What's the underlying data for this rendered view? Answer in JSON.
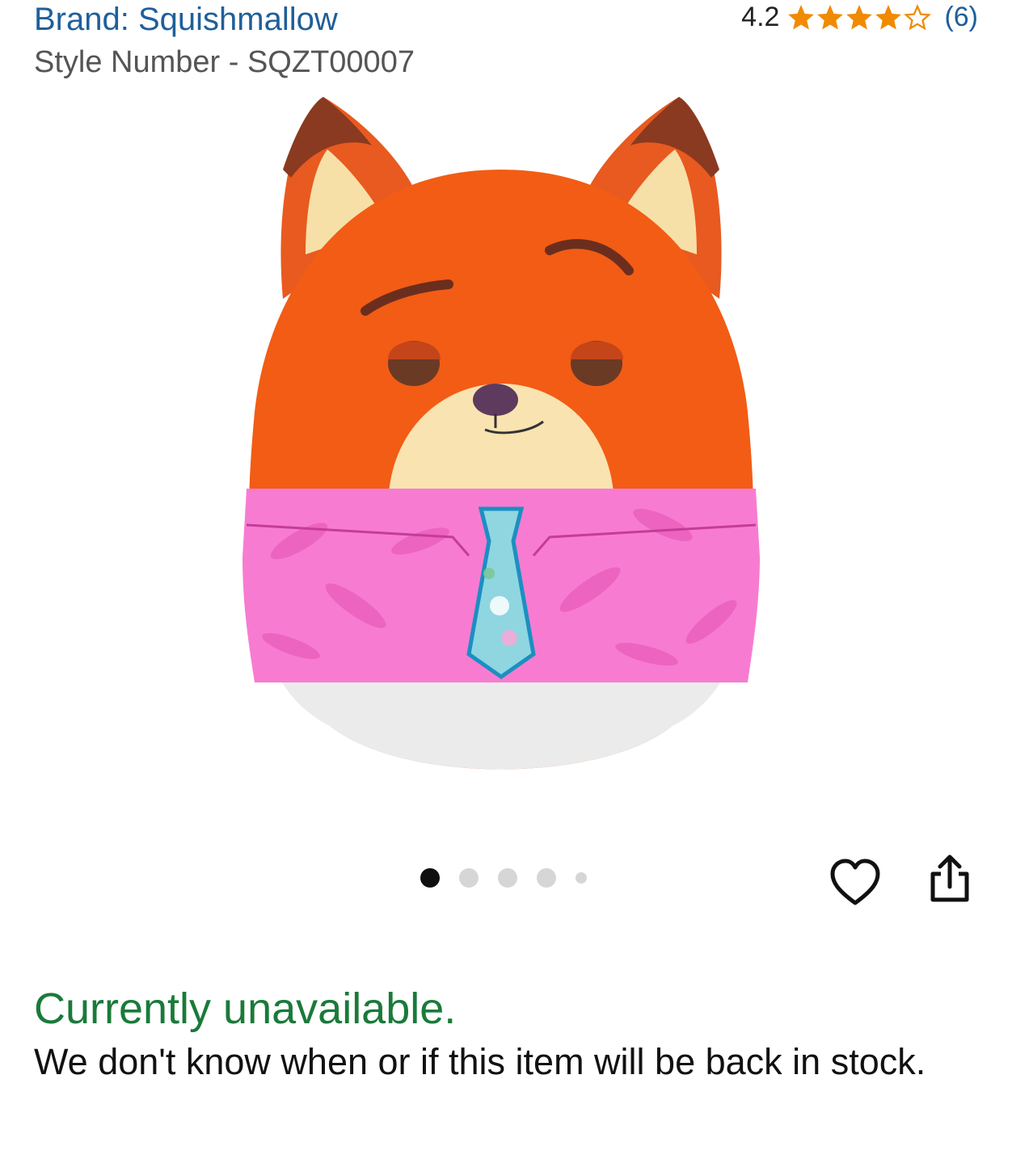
{
  "header": {
    "brand": "Brand: Squishmallow",
    "style_number": "Style Number - SQZT00007"
  },
  "rating": {
    "value": "4.2",
    "stars_filled": 4,
    "stars_total": 5,
    "count": "(6)",
    "star_color": "#f08a00"
  },
  "image_carousel": {
    "total_images": 5,
    "current_index": 0
  },
  "actions": {
    "wishlist_icon": "heart-icon",
    "share_icon": "share-icon"
  },
  "availability": {
    "status": "Currently unavailable.",
    "message": "We don't know when or if this item will be back in stock.",
    "status_color": "#1a7a3a"
  }
}
